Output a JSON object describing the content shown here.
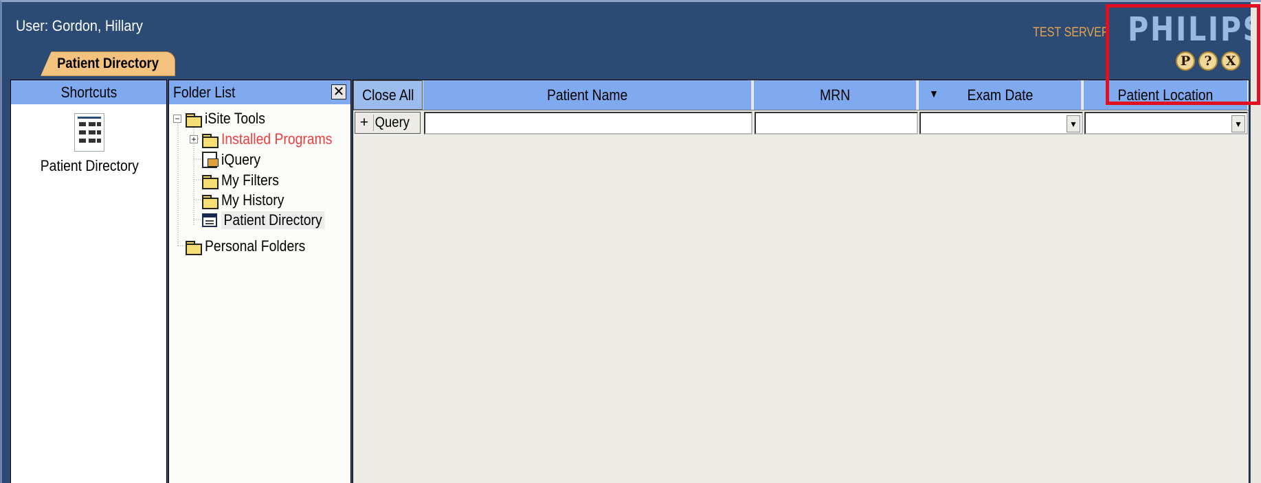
{
  "header": {
    "user_label": "User: Gordon, Hillary",
    "active_tab": "Patient Directory",
    "server_label": "TEST SERVER",
    "brand": "PHILIPS",
    "buttons": [
      "P",
      "?",
      "X"
    ]
  },
  "shortcuts": {
    "title": "Shortcuts",
    "items": [
      {
        "label": "Patient Directory",
        "icon": "patient-directory-icon"
      }
    ]
  },
  "folder_list": {
    "title": "Folder List",
    "close_label": "✕",
    "items": [
      {
        "label": "iSite Tools",
        "icon": "folder-icon",
        "expander": "−"
      },
      {
        "label": "Installed Programs",
        "icon": "folder-icon",
        "expander": "+",
        "color": "#f03c3c"
      },
      {
        "label": "iQuery",
        "icon": "query-icon"
      },
      {
        "label": "My Filters",
        "icon": "folder-icon"
      },
      {
        "label": "My History",
        "icon": "folder-icon"
      },
      {
        "label": "Patient Directory",
        "icon": "directory-icon",
        "selected": true
      },
      {
        "label": "Personal Folders",
        "icon": "folder-icon"
      }
    ]
  },
  "grid": {
    "close_all": "Close All",
    "columns": [
      "Patient Name",
      "MRN",
      "Exam Date",
      "Patient Location"
    ],
    "sort_indicator": "▼",
    "query_plus": "+",
    "query_label": "Query",
    "filters": {
      "patient_name": "",
      "mrn": "",
      "exam_date": "",
      "patient_location": ""
    }
  },
  "colors": {
    "background": "#2b4b74",
    "header_blue": "#7faaf0",
    "tab": "#f3c27f",
    "server_text": "#e7a24b",
    "highlight": "#e01020"
  }
}
